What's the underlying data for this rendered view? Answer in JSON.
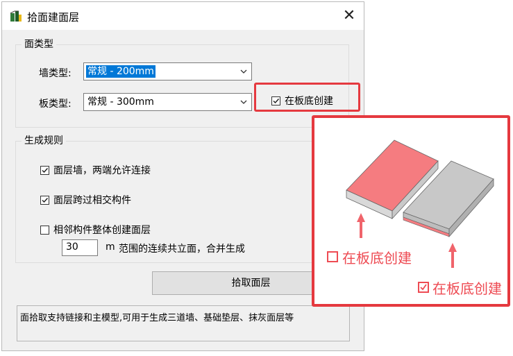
{
  "window": {
    "title": "拾面建面层"
  },
  "face_type_group": {
    "label": "面类型",
    "wall_type": {
      "label": "墙类型:",
      "value": "常规 - 200mm"
    },
    "slab_type": {
      "label": "板类型:",
      "value": "常规 - 300mm"
    },
    "create_under_slab": {
      "label": "在板底创建",
      "checked": true
    }
  },
  "rules_group": {
    "label": "生成规则",
    "options": [
      {
        "label": "面层墙，两端允许连接",
        "checked": true
      },
      {
        "label": "面层跨过相交构件",
        "checked": true
      },
      {
        "label": "相邻构件整体创建面层",
        "checked": false
      }
    ],
    "range": {
      "value": "30",
      "unit": "m",
      "suffix": "范围的连续共立面，合并生成"
    }
  },
  "pick_button": {
    "label": "拾取面层"
  },
  "description": "面拾取支持链接和主模型,可用于生成三道墙、基础垫层、抹灰面层等",
  "callout": {
    "unchecked_label": "在板底创建",
    "checked_label": "在板底创建"
  },
  "colors": {
    "accent": "#e5393f",
    "selection": "#0078d7",
    "slab_red": "#f57c80",
    "slab_gray": "#c6c6c6"
  },
  "icons": [
    "app-icon",
    "close-icon",
    "chevron-down-icon",
    "check-icon",
    "arrow-up-icon"
  ]
}
